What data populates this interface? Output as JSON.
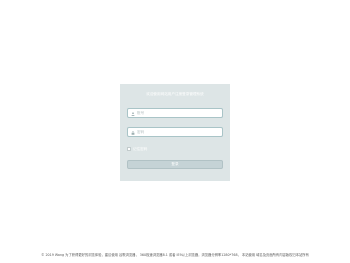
{
  "login": {
    "title": "欢迎使用网站用户注册登录管理系统",
    "username_placeholder": "账号",
    "password_placeholder": "密码",
    "remember_label": "记住密码",
    "submit_label": "登录"
  },
  "footer": {
    "text": "© 2019 Wang 为了获得更好的浏览体验，建议使用 谷歌浏览器， 360极速浏览器8.1 或者 IE9以上浏览器，浏览器分辨率1280*768， 本站使用 域名及页面所有内容版权归本站所有"
  },
  "colors": {
    "panel_bg": "#dde5e6",
    "field_border": "#a9c4c7",
    "button_bg": "#c5d3d6"
  },
  "icons": {
    "username": "user-icon",
    "password": "lock-icon"
  }
}
